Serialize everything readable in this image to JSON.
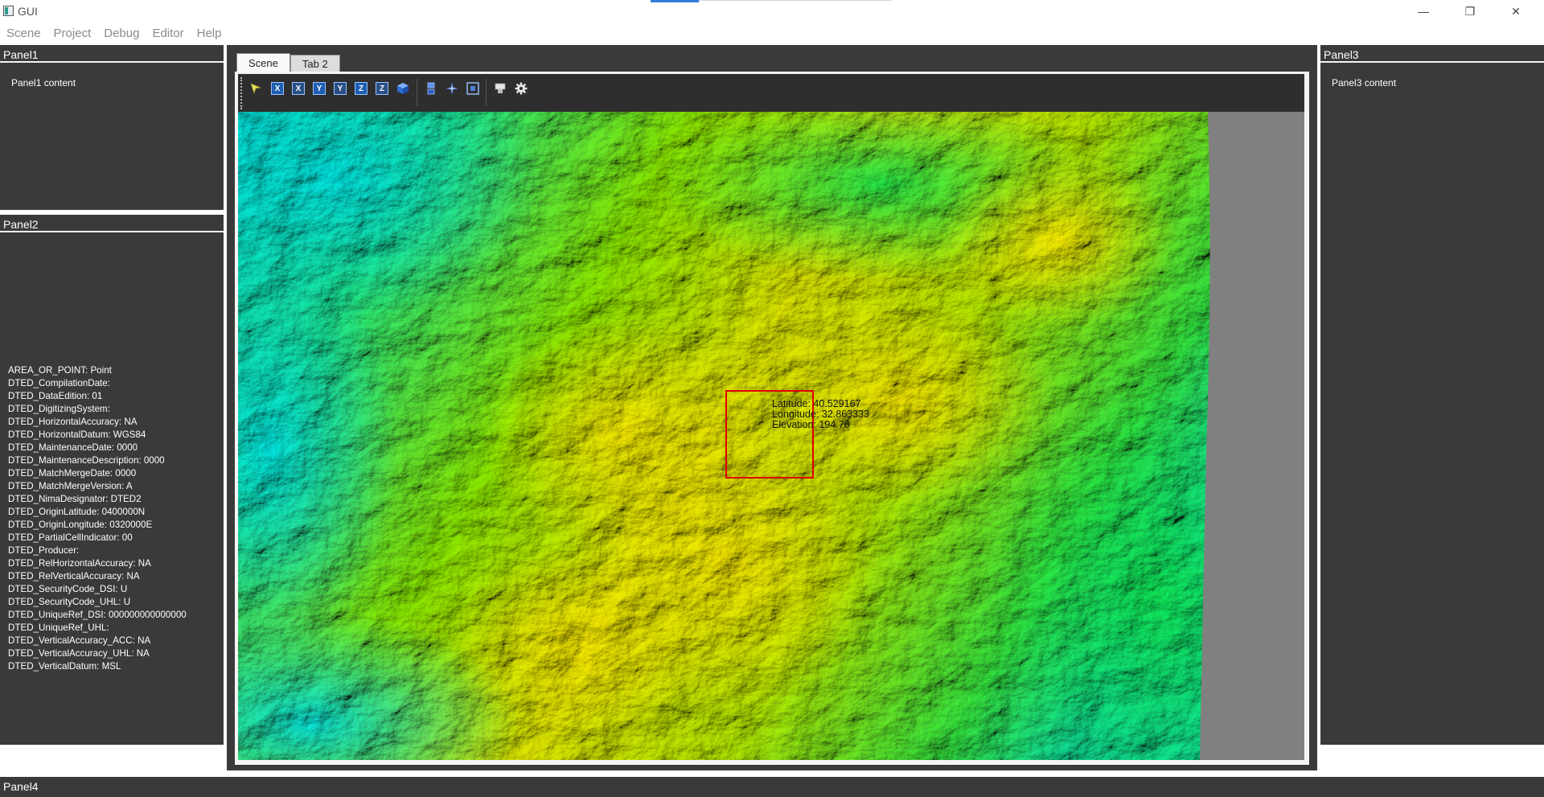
{
  "window": {
    "title": "GUI",
    "minimize_glyph": "—",
    "maximize_glyph": "❐",
    "close_glyph": "✕"
  },
  "menu": [
    "Scene",
    "Project",
    "Debug",
    "Editor",
    "Help"
  ],
  "panel1": {
    "title": "Panel1",
    "content": "Panel1 content"
  },
  "panel2": {
    "title": "Panel2",
    "metadata": [
      "AREA_OR_POINT: Point",
      "DTED_CompilationDate:",
      "DTED_DataEdition: 01",
      "DTED_DigitizingSystem:",
      "DTED_HorizontalAccuracy: NA",
      "DTED_HorizontalDatum: WGS84",
      "DTED_MaintenanceDate: 0000",
      "DTED_MaintenanceDescription: 0000",
      "DTED_MatchMergeDate: 0000",
      "DTED_MatchMergeVersion: A",
      "DTED_NimaDesignator: DTED2",
      "DTED_OriginLatitude: 0400000N",
      "DTED_OriginLongitude: 0320000E",
      "DTED_PartialCellIndicator: 00",
      "DTED_Producer:",
      "DTED_RelHorizontalAccuracy: NA",
      "DTED_RelVerticalAccuracy: NA",
      "DTED_SecurityCode_DSI: U",
      "DTED_SecurityCode_UHL: U",
      "DTED_UniqueRef_DSI: 000000000000000",
      "DTED_UniqueRef_UHL:",
      "DTED_VerticalAccuracy_ACC: NA",
      "DTED_VerticalAccuracy_UHL: NA",
      "DTED_VerticalDatum: MSL"
    ]
  },
  "panel3": {
    "title": "Panel3",
    "content": "Panel3 content"
  },
  "panel4": {
    "title": "Panel4"
  },
  "center": {
    "tabs": [
      "Scene",
      "Tab 2"
    ],
    "active_tab": "Scene",
    "toolbar": {
      "icons": [
        "select-arrow-icon",
        "view-pos-x-icon",
        "view-neg-x-icon",
        "view-pos-y-icon",
        "view-neg-y-icon",
        "view-pos-z-icon",
        "view-neg-z-icon",
        "perspective-cube-icon",
        "layers-icon",
        "compass-icon",
        "fit-view-icon",
        "screenshot-icon",
        "settings-gear-icon"
      ],
      "axis_labels": [
        "X",
        "X",
        "Y",
        "Y",
        "Z",
        "Z"
      ]
    },
    "probe": {
      "latitude": "Latitude: 40.529167",
      "longitude": "Longitude: 32.863333",
      "elevation": "Elevation: 194.70"
    }
  },
  "colors": {
    "panel_bg": "#3a3a3a",
    "terrain_low": "#00e5e0",
    "terrain_mid": "#5ff000",
    "terrain_high": "#ffee00",
    "probe_box": "#e00000",
    "void": "#808080"
  }
}
